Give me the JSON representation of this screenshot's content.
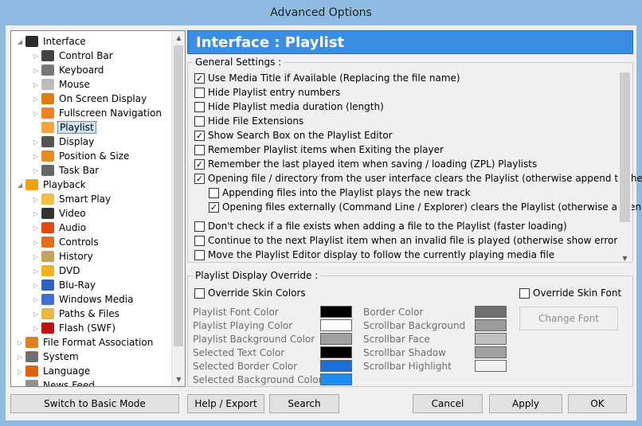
{
  "window": {
    "title": "Advanced Options"
  },
  "tree": {
    "items": [
      {
        "label": "Interface",
        "icon": "interface-icon",
        "color": "#2a2a2a"
      },
      {
        "label": "Control Bar",
        "icon": "control-bar-icon",
        "color": "#444444"
      },
      {
        "label": "Keyboard",
        "icon": "keyboard-icon",
        "color": "#777777"
      },
      {
        "label": "Mouse",
        "icon": "mouse-icon",
        "color": "#bbbbbb"
      },
      {
        "label": "On Screen Display",
        "icon": "osd-icon",
        "color": "#e07a10"
      },
      {
        "label": "Fullscreen Navigation",
        "icon": "fullscreen-icon",
        "color": "#f08020"
      },
      {
        "label": "Playlist",
        "icon": "playlist-icon",
        "color": "#f4a340"
      },
      {
        "label": "Display",
        "icon": "display-icon",
        "color": "#555555"
      },
      {
        "label": "Position & Size",
        "icon": "position-icon",
        "color": "#e88a20"
      },
      {
        "label": "Task Bar",
        "icon": "taskbar-icon",
        "color": "#666666"
      },
      {
        "label": "Playback",
        "icon": "playback-icon",
        "color": "#f0a010"
      },
      {
        "label": "Smart Play",
        "icon": "smart-play-icon",
        "color": "#f5c040"
      },
      {
        "label": "Video",
        "icon": "video-icon",
        "color": "#333333"
      },
      {
        "label": "Audio",
        "icon": "audio-icon",
        "color": "#e04a10"
      },
      {
        "label": "Controls",
        "icon": "controls-icon",
        "color": "#e07020"
      },
      {
        "label": "History",
        "icon": "history-icon",
        "color": "#c8a060"
      },
      {
        "label": "DVD",
        "icon": "dvd-icon",
        "color": "#f0b020"
      },
      {
        "label": "Blu-Ray",
        "icon": "bluray-icon",
        "color": "#3060c0"
      },
      {
        "label": "Windows Media",
        "icon": "windows-media-icon",
        "color": "#4070d0"
      },
      {
        "label": "Paths & Files",
        "icon": "folder-icon",
        "color": "#e8b840"
      },
      {
        "label": "Flash (SWF)",
        "icon": "flash-icon",
        "color": "#c01010"
      },
      {
        "label": "File Format Association",
        "icon": "file-format-icon",
        "color": "#e08020"
      },
      {
        "label": "System",
        "icon": "system-icon",
        "color": "#707070"
      },
      {
        "label": "Language",
        "icon": "language-icon",
        "color": "#e06010"
      },
      {
        "label": "News Feed",
        "icon": "news-icon",
        "color": "#909090"
      }
    ]
  },
  "panel": {
    "title": "Interface : Playlist"
  },
  "general": {
    "label": "General Settings :",
    "items": [
      {
        "label": "Use Media Title if Available (Replacing the file name)",
        "checked": true
      },
      {
        "label": "Hide Playlist entry numbers",
        "checked": false
      },
      {
        "label": "Hide Playlist media duration (length)",
        "checked": false
      },
      {
        "label": "Hide File Extensions",
        "checked": false
      },
      {
        "label": "Show Search Box on the Playlist Editor",
        "checked": true
      },
      {
        "label": "Remember Playlist items when Exiting the player",
        "checked": false
      },
      {
        "label": "Remember the last played item when saving / loading (ZPL) Playlists",
        "checked": true
      },
      {
        "label": "Opening file / directory from the user interface clears the Playlist (otherwise append to the list)",
        "checked": true
      },
      {
        "label": "Appending files into the Playlist plays the new track",
        "checked": false
      },
      {
        "label": "Opening files externally (Command Line / Explorer) clears the Playlist (otherwise append)",
        "checked": true
      },
      {
        "label": "Don't check if a file exists when adding a file to the Playlist (faster loading)",
        "checked": false
      },
      {
        "label": "Continue to the next Playlist item when an invalid file is played (otherwise show error)",
        "checked": false
      },
      {
        "label": "Move the Playlist Editor display to follow the currently playing media file",
        "checked": false
      }
    ]
  },
  "override": {
    "label": "Playlist Display Override :",
    "skin_colors": "Override Skin Colors",
    "skin_font": "Override Skin Font",
    "change_font": "Change Font",
    "left": [
      {
        "label": "Playlist Font Color",
        "color": "#000000"
      },
      {
        "label": "Playlist Playing Color",
        "color": "#ffffff"
      },
      {
        "label": "Playlist Background Color",
        "color": "#a0a0a0"
      },
      {
        "label": "Selected Text Color",
        "color": "#000000"
      },
      {
        "label": "Selected Border Color",
        "color": "#1a6fd8"
      },
      {
        "label": "Selected Background Color",
        "color": "#1e8cf0"
      }
    ],
    "right": [
      {
        "label": "Border Color",
        "color": "#707070"
      },
      {
        "label": "Scrollbar Background",
        "color": "#9a9a9a"
      },
      {
        "label": "Scrollbar Face",
        "color": "#c0c0c0"
      },
      {
        "label": "Scrollbar Shadow",
        "color": "#a0a0a0"
      },
      {
        "label": "Scrollbar Highlight",
        "color": "#f0f0f0"
      }
    ]
  },
  "buttons": {
    "basic": "Switch to Basic Mode",
    "help": "Help / Export",
    "search": "Search",
    "cancel": "Cancel",
    "apply": "Apply",
    "ok": "OK"
  }
}
